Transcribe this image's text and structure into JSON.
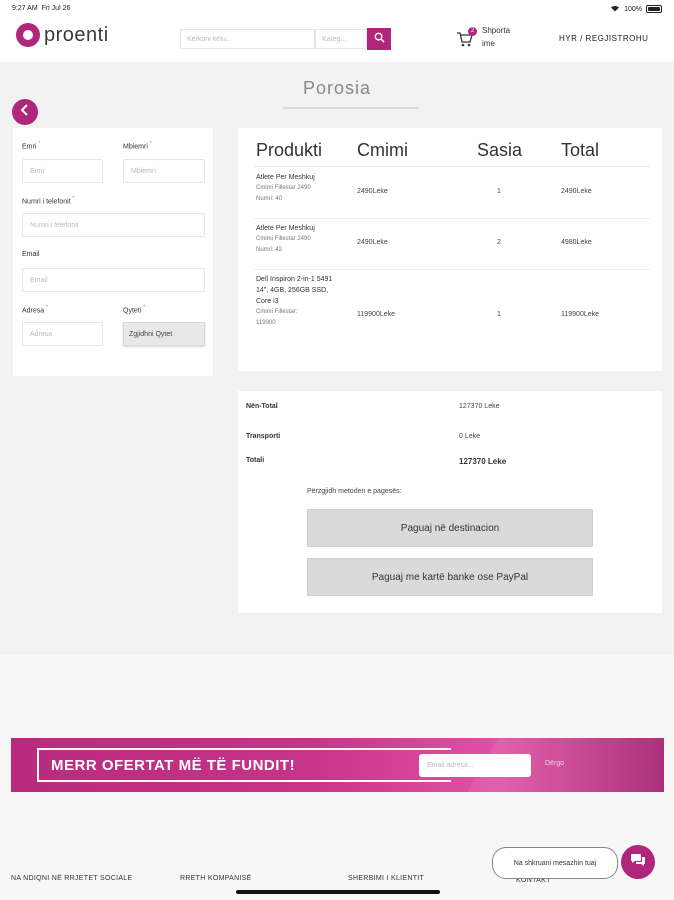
{
  "status_bar": {
    "time": "9:27 AM",
    "date": "Fri Jul 26",
    "battery": "100%"
  },
  "header": {
    "logo_text": "proenti",
    "search_placeholder": "Kërkoni këtu...",
    "category_placeholder": "Kateg...",
    "cart_label": "Shporta",
    "cart_sub": "ime",
    "cart_count": "2",
    "login_label": "HYR / REGJISTROHU"
  },
  "page": {
    "title": "Porosia"
  },
  "form": {
    "emri_label": "Emri",
    "emri_placeholder": "Emri",
    "mbiemri_label": "Mbiemri",
    "mbiemri_placeholder": "Mbiemri",
    "phone_label": "Numri i telefonit",
    "phone_placeholder": "Numri i telefonit",
    "email_label": "Email",
    "email_placeholder": "Email",
    "address_label": "Adresa",
    "address_placeholder": "Adresa",
    "city_label": "Qyteti",
    "city_value": "Zgjidhni Qytet"
  },
  "products": {
    "headers": {
      "product": "Produkti",
      "price": "Cmimi",
      "qty": "Sasia",
      "total": "Total"
    },
    "rows": [
      {
        "name": "Atlete Per Meshkuj",
        "meta1": "Cmimi Fillestar 2490",
        "meta2": "Numri: 40",
        "price": "2490Leke",
        "qty": "1",
        "total": "2490Leke"
      },
      {
        "name": "Atlete Per Meshkuj",
        "meta1": "Cmimi Fillestar 2490",
        "meta2": "Numri: 42",
        "price": "2490Leke",
        "qty": "2",
        "total": "4980Leke"
      },
      {
        "name": "Dell Inspiron 2-in-1 5491 14\", 4GB, 256GB SSD, Core i3",
        "meta1": "Cmimi Fillestar:",
        "meta2": "119900",
        "price": "119900Leke",
        "qty": "1",
        "total": "119900Leke"
      }
    ]
  },
  "totals": {
    "subtotal_label": "Nën-Total",
    "subtotal_value": "127370 Leke",
    "shipping_label": "Transporti",
    "shipping_value": "0 Leke",
    "total_label": "Totali",
    "total_value": "127370 Leke",
    "payment_hint": "Përzgjidh metoden e pagesës:",
    "pay_destination": "Paguaj në destinacion",
    "pay_card": "Paguaj me kartë banke ose PayPal"
  },
  "newsletter": {
    "headline": "MERR OFERTAT MË TË FUNDIT!",
    "email_placeholder": "Email adresa...",
    "submit_label": "Dërgo"
  },
  "footer": {
    "col1": "NA NDIQNI NË RRJETET SOCIALE",
    "col2": "RRETH KOMPANISË",
    "col3": "SHERBIMI I KLIENTIT",
    "col4": "KONTAKT",
    "chat_prompt": "Na shkruani mesazhin tuaj"
  },
  "colors": {
    "accent": "#b0267a",
    "page_bg": "#f2f2f3",
    "card_bg": "#ffffff"
  }
}
